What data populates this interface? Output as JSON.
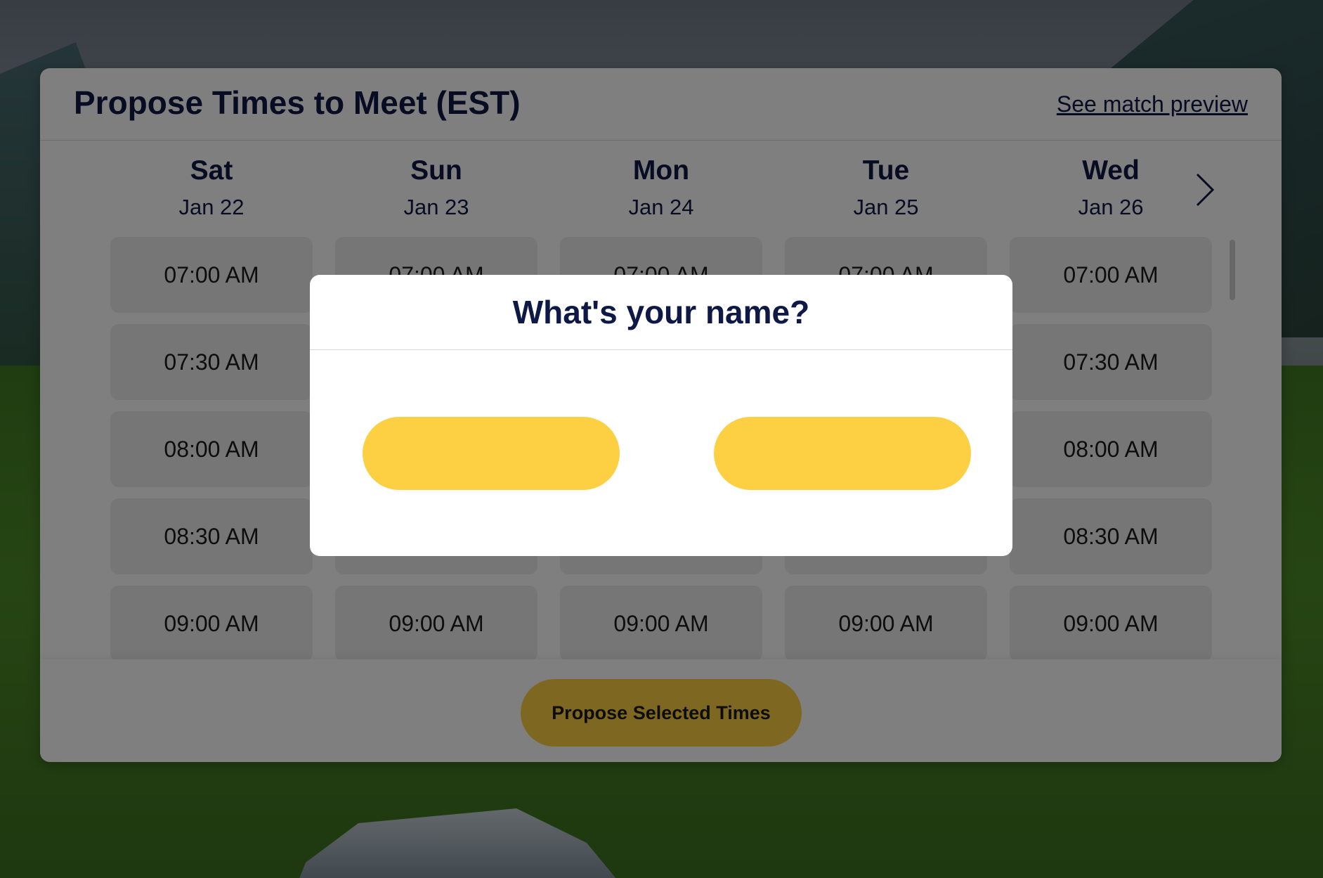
{
  "header": {
    "title": "Propose Times to Meet (EST)",
    "match_preview_link": "See match preview"
  },
  "days": [
    {
      "name": "Sat",
      "date": "Jan 22"
    },
    {
      "name": "Sun",
      "date": "Jan 23"
    },
    {
      "name": "Mon",
      "date": "Jan 24"
    },
    {
      "name": "Tue",
      "date": "Jan 25"
    },
    {
      "name": "Wed",
      "date": "Jan 26"
    }
  ],
  "time_slots": [
    "07:00 AM",
    "07:30 AM",
    "08:00 AM",
    "08:30 AM",
    "09:00 AM"
  ],
  "footer": {
    "propose_button": "Propose Selected Times"
  },
  "modal": {
    "title": "What's your name?",
    "buttons": [
      "",
      ""
    ]
  },
  "icons": {
    "next": "chevron-right-icon"
  },
  "colors": {
    "accent": "#fdd043",
    "title_text": "#0f1946",
    "slot_bg": "#ececec",
    "overlay": "rgba(0,0,0,0.5)"
  }
}
